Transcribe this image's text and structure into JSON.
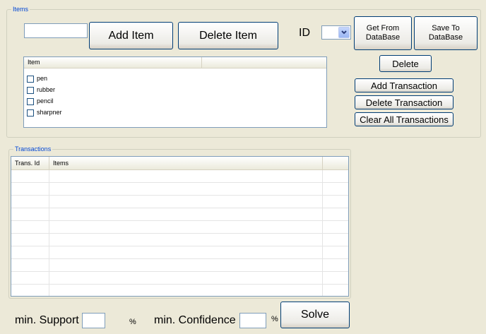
{
  "items_group": {
    "caption": "Items",
    "item_input_value": "",
    "add_item_label": "Add Item",
    "delete_item_label": "Delete Item",
    "id_label": "ID",
    "id_select_value": "",
    "get_from_db_label": "Get From\nDataBase",
    "save_to_db_label": "Save To\nDataBase",
    "delete_label": "Delete",
    "add_transaction_label": "Add Transaction",
    "delete_transaction_label": "Delete Transaction",
    "clear_all_label": "Clear All Transactions",
    "items_list": {
      "column_header": "Item",
      "rows": [
        {
          "label": "pen",
          "checked": false
        },
        {
          "label": "rubber",
          "checked": false
        },
        {
          "label": "pencil",
          "checked": false
        },
        {
          "label": "sharpner",
          "checked": false
        }
      ]
    }
  },
  "transactions_group": {
    "caption": "Transactions",
    "columns": [
      "Trans. Id",
      "Items"
    ],
    "rows": []
  },
  "footer": {
    "min_support_label": "min. Support",
    "min_support_value": "",
    "percent_symbol_1": "%",
    "min_confidence_label": "min. Confidence",
    "min_confidence_value": "",
    "percent_symbol_2": "%",
    "solve_label": "Solve"
  },
  "icons": {
    "dropdown_arrow": "chevron-down-icon"
  }
}
